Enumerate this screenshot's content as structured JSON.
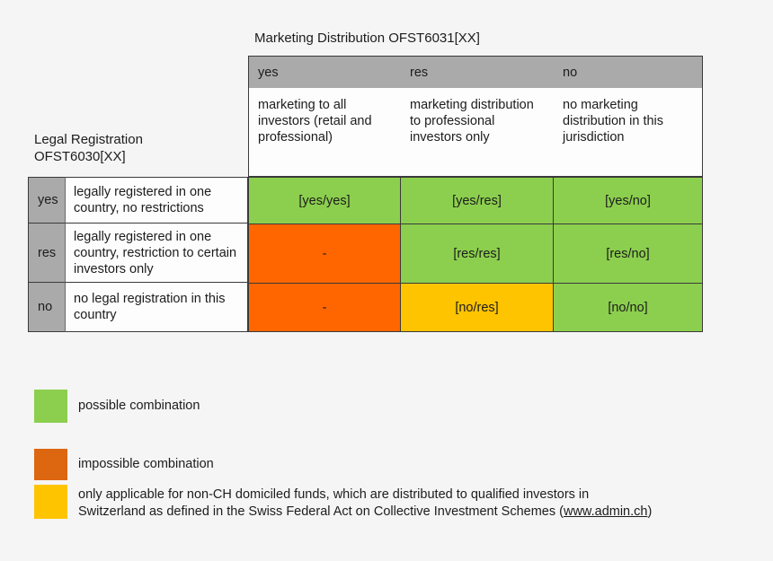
{
  "matrix": {
    "column_group_title": "Marketing Distribution OFST6031[XX]",
    "row_group_title": "Legal Registration\nOFST6030[XX]",
    "column_keys": [
      "yes",
      "res",
      "no"
    ],
    "column_descriptions": [
      "marketing to all investors (retail and professional)",
      "marketing distribution to professional investors only",
      "no marketing distribution in this jurisdiction"
    ],
    "row_keys": [
      "yes",
      "res",
      "no"
    ],
    "row_descriptions": [
      "legally registered in one country, no restrictions",
      "legally registered in one country, restriction to certain investors only",
      "no legal registration in this country"
    ],
    "cells": [
      [
        {
          "label": "[yes/yes]",
          "state": "possible"
        },
        {
          "label": "[yes/res]",
          "state": "possible"
        },
        {
          "label": "[yes/no]",
          "state": "possible"
        }
      ],
      [
        {
          "label": "-",
          "state": "impossible"
        },
        {
          "label": "[res/res]",
          "state": "possible"
        },
        {
          "label": "[res/no]",
          "state": "possible"
        }
      ],
      [
        {
          "label": "-",
          "state": "impossible"
        },
        {
          "label": "[no/res]",
          "state": "conditional"
        },
        {
          "label": "[no/no]",
          "state": "possible"
        }
      ]
    ]
  },
  "legend": {
    "items": [
      {
        "swatch": "green",
        "text": "possible combination"
      },
      {
        "swatch": "orange",
        "text": "impossible combination"
      },
      {
        "swatch": "yellow",
        "text": "only applicable for non-CH domiciled funds, which are distributed to qualified investors in\nSwitzerland as defined in the Swiss Federal Act on Collective Investment Schemes ("
      }
    ],
    "link_text": "www.admin.ch",
    "link_suffix": ")"
  },
  "colors": {
    "possible": "#8ccf4e",
    "impossible": "#ff6600",
    "conditional": "#ffc400",
    "legend_impossible": "#dd6611",
    "header_grey": "#aaaaaa",
    "background": "#f5f5f5",
    "border": "#3a3a3a"
  }
}
